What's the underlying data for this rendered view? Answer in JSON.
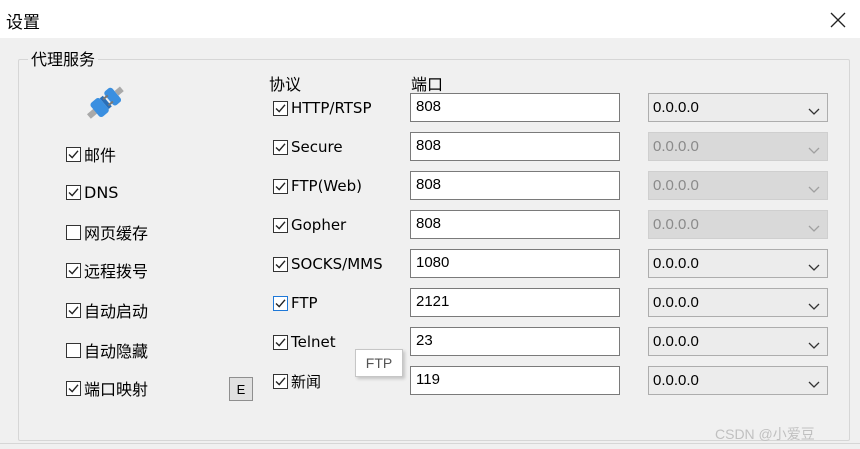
{
  "window": {
    "title": "设置"
  },
  "group": {
    "title": "代理服务"
  },
  "services": [
    {
      "label": "邮件",
      "checked": true
    },
    {
      "label": "DNS",
      "checked": true
    },
    {
      "label": "网页缓存",
      "checked": false
    },
    {
      "label": "远程拨号",
      "checked": true
    },
    {
      "label": "自动启动",
      "checked": true
    },
    {
      "label": "自动隐藏",
      "checked": false
    },
    {
      "label": "端口映射",
      "checked": true
    }
  ],
  "edit_button_label": "E",
  "headers": {
    "protocol": "协议",
    "port": "端口"
  },
  "protocols": [
    {
      "name": "HTTP/RTSP",
      "checked": true,
      "port": "808",
      "address": "0.0.0.0",
      "address_enabled": true
    },
    {
      "name": "Secure",
      "checked": true,
      "port": "808",
      "address": "0.0.0.0",
      "address_enabled": false
    },
    {
      "name": "FTP(Web)",
      "checked": true,
      "port": "808",
      "address": "0.0.0.0",
      "address_enabled": false
    },
    {
      "name": "Gopher",
      "checked": true,
      "port": "808",
      "address": "0.0.0.0",
      "address_enabled": false
    },
    {
      "name": "SOCKS/MMS",
      "checked": true,
      "port": "1080",
      "address": "0.0.0.0",
      "address_enabled": true
    },
    {
      "name": "FTP",
      "checked": true,
      "port": "2121",
      "address": "0.0.0.0",
      "address_enabled": true,
      "focused": true
    },
    {
      "name": "Telnet",
      "checked": true,
      "port": "23",
      "address": "0.0.0.0",
      "address_enabled": true
    },
    {
      "name": "新闻",
      "checked": true,
      "port": "119",
      "address": "0.0.0.0",
      "address_enabled": true
    }
  ],
  "tooltip": {
    "text": "FTP"
  },
  "watermark": "CSDN @小爱豆",
  "colors": {
    "window_bg": "#f0f0f0",
    "focus_blue": "#1e78d8",
    "disabled_bg": "#d9d9d9",
    "plug_blue": "#3a8fe0"
  }
}
